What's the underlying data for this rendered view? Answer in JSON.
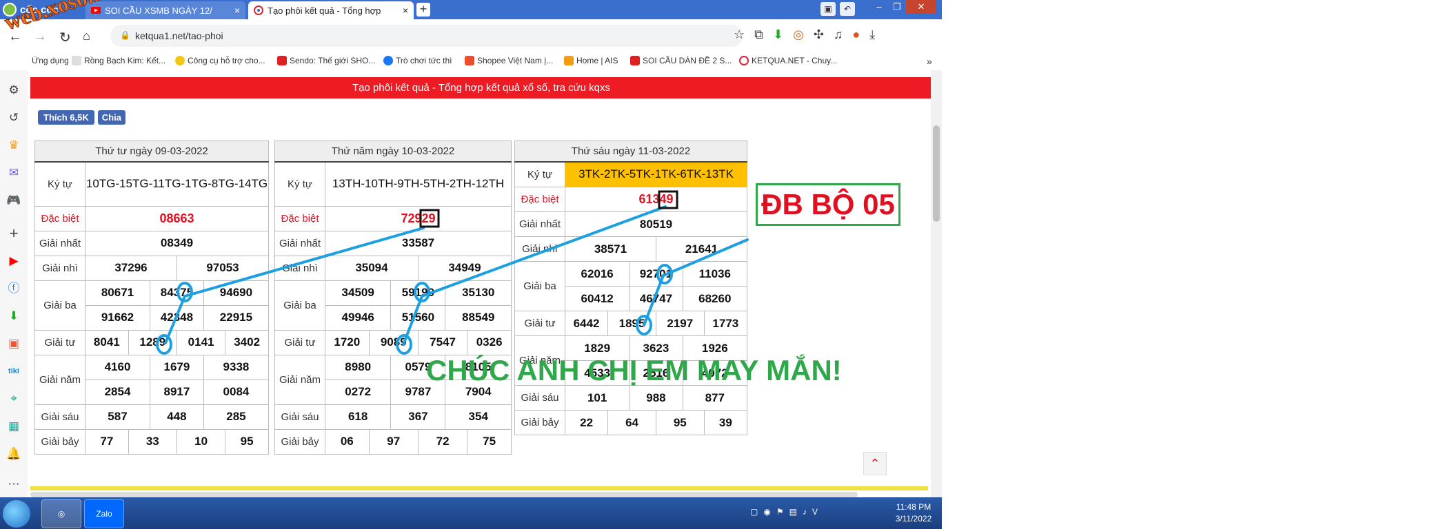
{
  "browser": {
    "brand": "cốc cốc",
    "tabs": [
      {
        "label": "SOI CẦU XSMB NGÀY 12/",
        "close": "×"
      },
      {
        "label": "Tạo phôi kết quả - Tổng hợp",
        "close": "×"
      }
    ],
    "new_tab": "+",
    "url": "ketqua1.net/tao-phoi",
    "bookmarks": [
      "Ứng dụng",
      "Rồng Bạch Kim: Kết...",
      "Công cụ hỗ trợ cho...",
      "Sendo: Thế giới SHO...",
      "Trò chơi tức thì",
      "Shopee Việt Nam |...",
      "Home | AIS",
      "SOI CẦU DÀN ĐỀ 2 S...",
      "KETQUA.NET - Chuy..."
    ],
    "more_bookmarks": "»"
  },
  "page": {
    "banner": "Tạo phôi kết quả - Tổng hợp kết quả xổ số, tra cứu kqxs",
    "fb_like": "Thích 6,5K",
    "fb_share": "Chia"
  },
  "labels": {
    "ky_tu": "Ký tự",
    "dac_biet": "Đặc biệt",
    "giai_nhat": "Giải nhất",
    "giai_nhi": "Giải nhì",
    "giai_ba": "Giải ba",
    "giai_tu": "Giải tư",
    "giai_nam": "Giải năm",
    "giai_sau": "Giải sáu",
    "giai_bay": "Giải bảy"
  },
  "tables": [
    {
      "date": "Thứ tư ngày 09-03-2022",
      "ky_tu": "10TG-15TG-11TG-1TG-8TG-14TG",
      "dac_biet": "08663",
      "giai_nhat": "08349",
      "giai_nhi": [
        "37296",
        "97053"
      ],
      "giai_ba": [
        "80671",
        "84375",
        "94690",
        "91662",
        "42348",
        "22915"
      ],
      "giai_tu": [
        "8041",
        "1289",
        "0141",
        "3402"
      ],
      "giai_nam": [
        "4160",
        "1679",
        "9338",
        "2854",
        "8917",
        "0084"
      ],
      "giai_sau": [
        "587",
        "448",
        "285"
      ],
      "giai_bay": [
        "77",
        "33",
        "10",
        "95"
      ]
    },
    {
      "date": "Thứ năm ngày 10-03-2022",
      "ky_tu": "13TH-10TH-9TH-5TH-2TH-12TH",
      "dac_biet": "72929",
      "giai_nhat": "33587",
      "giai_nhi": [
        "35094",
        "34949"
      ],
      "giai_ba": [
        "34509",
        "59190",
        "35130",
        "49946",
        "51560",
        "88549"
      ],
      "giai_tu": [
        "1720",
        "9089",
        "7547",
        "0326"
      ],
      "giai_nam": [
        "8980",
        "0579",
        "8105",
        "0272",
        "9787",
        "7904"
      ],
      "giai_sau": [
        "618",
        "367",
        "354"
      ],
      "giai_bay": [
        "06",
        "97",
        "72",
        "75"
      ]
    },
    {
      "date": "Thứ sáu ngày 11-03-2022",
      "ky_tu": "3TK-2TK-5TK-1TK-6TK-13TK",
      "dac_biet": "61349",
      "giai_nhat": "80519",
      "giai_nhi": [
        "38571",
        "21641"
      ],
      "giai_ba": [
        "62016",
        "92701",
        "11036",
        "60412",
        "46747",
        "68260"
      ],
      "giai_tu": [
        "6442",
        "1895",
        "2197",
        "1773"
      ],
      "giai_nam": [
        "1829",
        "3623",
        "1926",
        "4533",
        "2516",
        "4072"
      ],
      "giai_sau": [
        "101",
        "988",
        "877"
      ],
      "giai_bay": [
        "22",
        "64",
        "95",
        "39"
      ]
    }
  ],
  "annotations": {
    "db_label": "ĐB BỘ 05",
    "luck": "CHÚC ANH CHỊ EM MAY MẮN!",
    "watermark": "web.xoso.net",
    "colors": {
      "line": "#1ea0e0",
      "green": "#2ea84a",
      "red": "#e01020"
    }
  },
  "taskbar": {
    "zalo": "Zalo",
    "time": "11:48 PM",
    "date": "3/11/2022"
  }
}
